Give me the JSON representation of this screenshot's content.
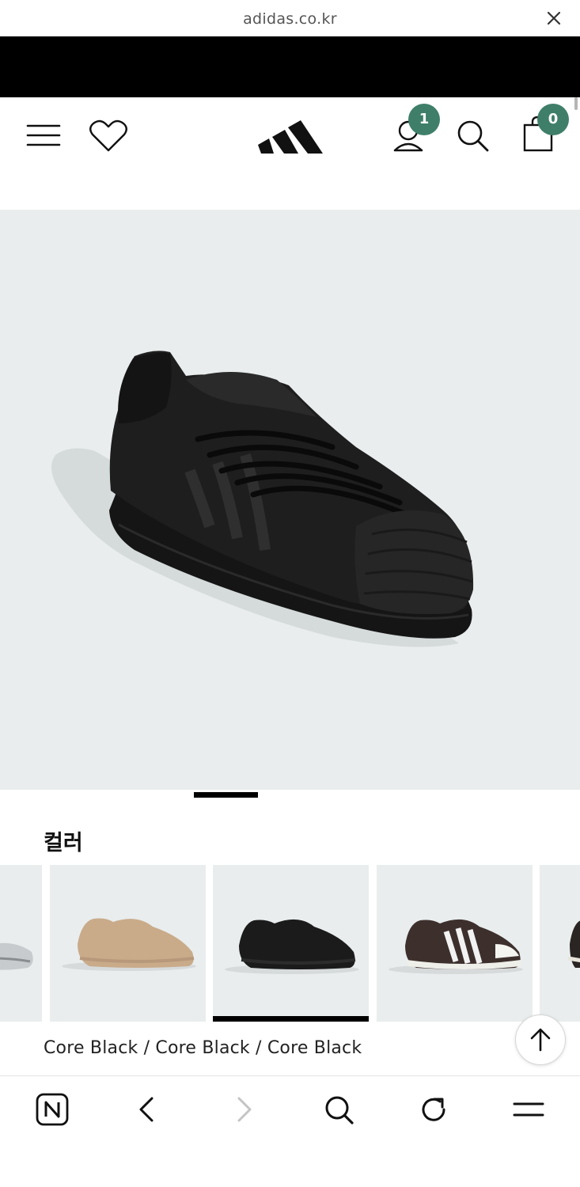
{
  "browser": {
    "url": "adidas.co.kr",
    "close_icon": "close-icon"
  },
  "header": {
    "menu_icon": "hamburger-menu-icon",
    "wishlist_icon": "heart-icon",
    "logo": "adidas-logo",
    "account_icon": "user-icon",
    "account_badge": "1",
    "search_icon": "search-icon",
    "cart_icon": "shopping-bag-icon",
    "cart_badge": "0",
    "badge_color": "#3f7f6a"
  },
  "product": {
    "image": "black-superstar-sneaker",
    "background_color": "#e9edee"
  },
  "colors": {
    "title": "컬러",
    "selected_name": "Core Black / Core Black / Core Black",
    "swatches": [
      {
        "name": "silver-sneaker"
      },
      {
        "name": "beige-sneaker"
      },
      {
        "name": "black-sneaker",
        "selected": true
      },
      {
        "name": "brown-white-sneaker"
      },
      {
        "name": "partial-sneaker"
      }
    ]
  },
  "scroll_top_icon": "arrow-up-icon",
  "bottom_bar": {
    "items": [
      "naver-icon",
      "back-icon",
      "forward-icon",
      "search-icon",
      "reload-icon",
      "menu-icon"
    ]
  }
}
